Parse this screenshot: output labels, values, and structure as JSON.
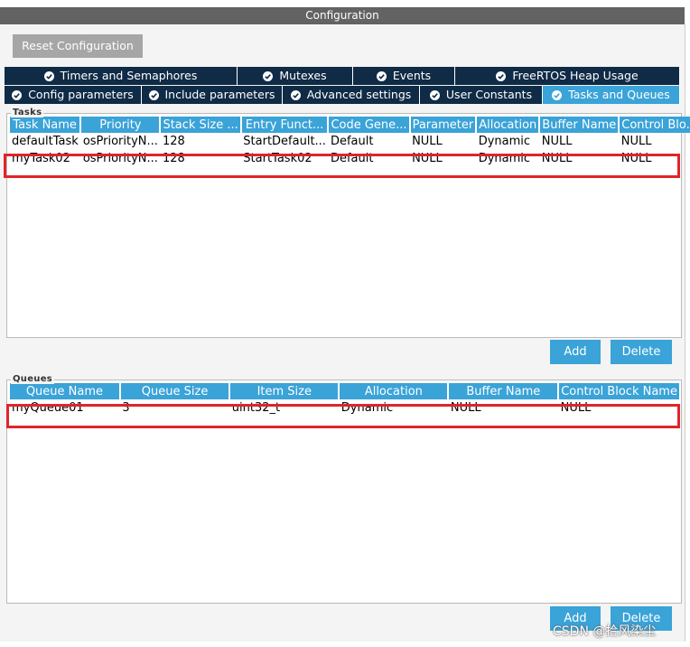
{
  "window": {
    "title": "Configuration"
  },
  "toolbar": {
    "reset_label": "Reset Configuration"
  },
  "tabs": {
    "row1": [
      {
        "label": "Timers and Semaphores",
        "active": false
      },
      {
        "label": "Mutexes",
        "active": false
      },
      {
        "label": "Events",
        "active": false
      },
      {
        "label": "FreeRTOS Heap Usage",
        "active": false
      }
    ],
    "row2": [
      {
        "label": "Config parameters",
        "active": false
      },
      {
        "label": "Include parameters",
        "active": false
      },
      {
        "label": "Advanced settings",
        "active": false
      },
      {
        "label": "User Constants",
        "active": false
      },
      {
        "label": "Tasks and Queues",
        "active": true
      }
    ]
  },
  "tasks": {
    "group_label": "Tasks",
    "columns": [
      "Task Name",
      "Priority",
      "Stack Size ...",
      "Entry Funct...",
      "Code Gene...",
      "Parameter",
      "Allocation",
      "Buffer Name",
      "Control Blo..."
    ],
    "rows": [
      [
        "defaultTask",
        "osPriorityN...",
        "128",
        "StartDefault...",
        "Default",
        "NULL",
        "Dynamic",
        "NULL",
        "NULL"
      ],
      [
        "myTask02",
        "osPriorityN...",
        "128",
        "StartTask02",
        "Default",
        "NULL",
        "Dynamic",
        "NULL",
        "NULL"
      ]
    ],
    "add_label": "Add",
    "delete_label": "Delete"
  },
  "queues": {
    "group_label": "Queues",
    "columns": [
      "Queue Name",
      "Queue Size",
      "Item Size",
      "Allocation",
      "Buffer Name",
      "Control Block Name"
    ],
    "rows": [
      [
        "myQueue01",
        "3",
        "uint32_t",
        "Dynamic",
        "NULL",
        "NULL"
      ]
    ],
    "add_label": "Add",
    "delete_label": "Delete"
  },
  "watermark": "CSDN @拾风染尘",
  "colors": {
    "accent": "#3aa3d8",
    "tab_dark": "#0f2b46",
    "highlight": "#e0242a"
  }
}
